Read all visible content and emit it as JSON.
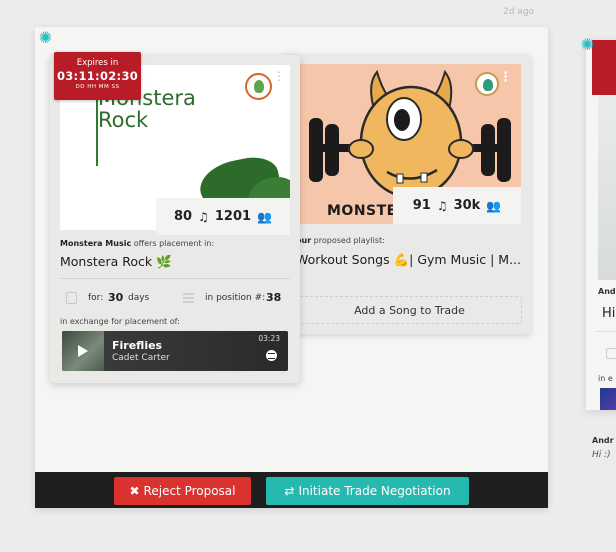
{
  "header": {
    "timestamp": "2d ago"
  },
  "offer": {
    "expires": {
      "label": "Expires in",
      "time": "03:11:02:30",
      "units": "DD HH MM  SS"
    },
    "art_title_line1": "Monstera",
    "art_title_line2": "Rock",
    "tracks": "80",
    "followers": "1201",
    "caption_bold": "Monstera Music",
    "caption_rest": " offers placement in:",
    "playlist_title": "Monstera Rock 🌿",
    "duration_label": "for:",
    "duration_value": "30",
    "duration_unit": "days",
    "position_label": "in position #:",
    "position_value": "38",
    "exchange_label": "in exchange for placement of:",
    "track": {
      "name": "Fireflies",
      "artist": "Cadet Carter",
      "time": "03:23"
    }
  },
  "proposed": {
    "art_text": "MONSTE",
    "tracks": "91",
    "followers": "30k",
    "caption_bold": "our",
    "caption_rest": " proposed playlist:",
    "playlist_title": "Workout Songs 💪| Gym Music | M...",
    "add_song_label": "Add a Song to Trade"
  },
  "peek": {
    "name": "And",
    "title": "Hi",
    "exchange": "in e",
    "msg_name": "Andr",
    "msg": "Hi :)"
  },
  "actions": {
    "reject_icon": "✖",
    "reject_label": "Reject Proposal",
    "trade_icon": "⇄",
    "trade_label": "Initiate Trade Negotiation"
  },
  "colors": {
    "brand_red": "#b71c27",
    "teal": "#26b9b0",
    "reject": "#d9322f"
  }
}
